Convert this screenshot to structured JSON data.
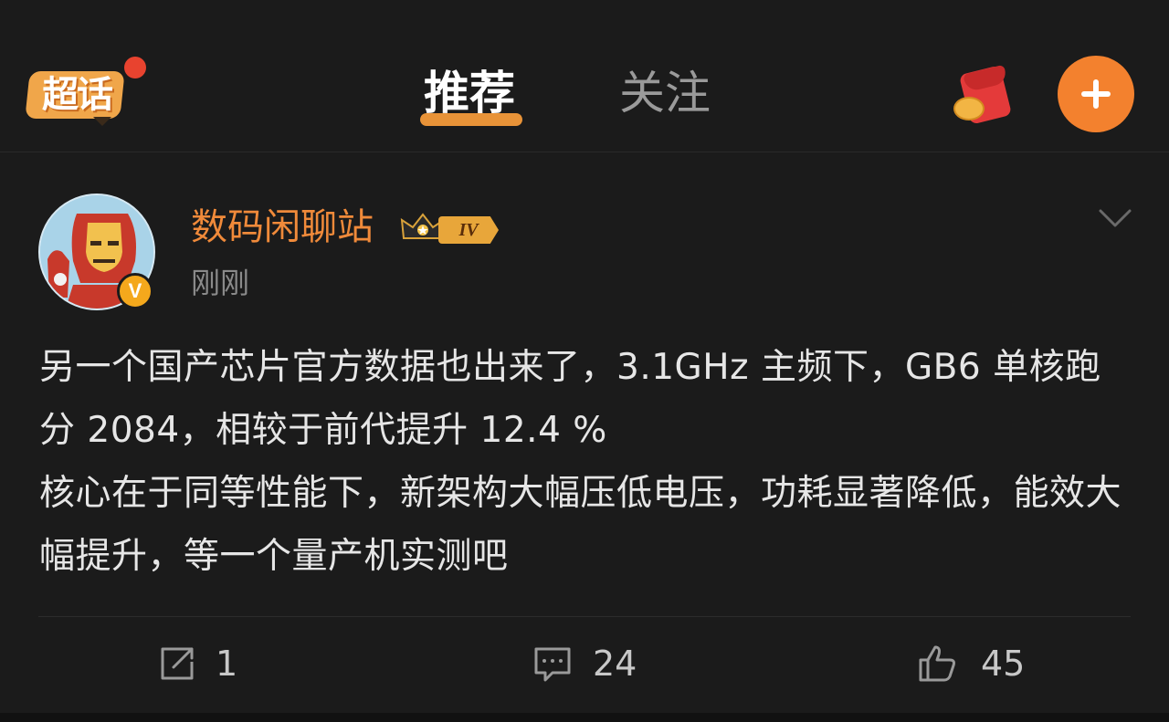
{
  "header": {
    "logo_text": "超话",
    "tabs": [
      {
        "label": "推荐",
        "active": true
      },
      {
        "label": "关注",
        "active": false
      }
    ],
    "accent_color": "#f3812e"
  },
  "post": {
    "author": {
      "name": "数码闲聊站",
      "level": "IV",
      "verified_mark": "V"
    },
    "time": "刚刚",
    "content": "另一个国产芯片官方数据也出来了，3.1GHz 主频下，GB6 单核跑分 2084，相较于前代提升 12.4 %\n核心在于同等性能下，新架构大幅压低电压，功耗显著降低，能效大幅提升，等一个量产机实测吧",
    "actions": {
      "reposts": "1",
      "comments": "24",
      "likes": "45"
    }
  }
}
